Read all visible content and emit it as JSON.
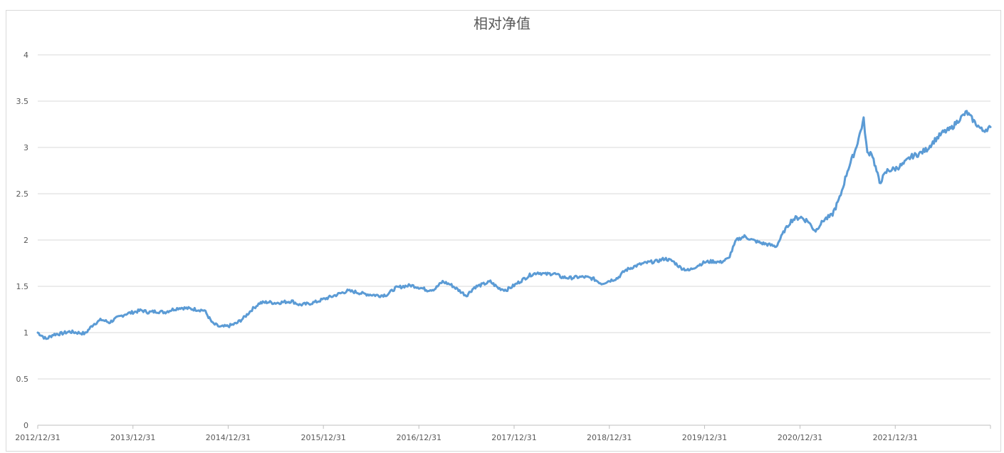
{
  "chart_data": {
    "type": "line",
    "title": "相对净值",
    "xlabel": "",
    "ylabel": "",
    "ylim": [
      0,
      4
    ],
    "yticks": [
      0,
      0.5,
      1,
      1.5,
      2,
      2.5,
      3,
      3.5,
      4
    ],
    "ytick_labels": [
      "0",
      "0.5",
      "1",
      "1.5",
      "2",
      "2.5",
      "3",
      "3.5",
      "4"
    ],
    "xticks": [
      "2012/12/31",
      "2013/12/31",
      "2014/12/31",
      "2015/12/31",
      "2016/12/31",
      "2017/12/31",
      "2018/12/31",
      "2019/12/31",
      "2020/12/31",
      "2021/12/31"
    ],
    "xlim": [
      "2012/12/31",
      "2022/12/31"
    ],
    "grid": true,
    "legend": "none",
    "line_color": "#5b9bd5",
    "series": [
      {
        "x": [
          "2012/12/31",
          "2013/01/15",
          "2013/02/01",
          "2013/03/01",
          "2013/04/01",
          "2013/05/01",
          "2013/06/01",
          "2013/07/01",
          "2013/08/01",
          "2013/09/01",
          "2013/10/01",
          "2013/11/01",
          "2013/12/01",
          "2013/12/31",
          "2014/02/01",
          "2014/03/01",
          "2014/04/01",
          "2014/05/01",
          "2014/06/01",
          "2014/07/01",
          "2014/08/01",
          "2014/09/01",
          "2014/10/01",
          "2014/11/01",
          "2014/12/01",
          "2014/12/31",
          "2015/02/01",
          "2015/03/01",
          "2015/04/01",
          "2015/05/01",
          "2015/06/01",
          "2015/07/01",
          "2015/08/01",
          "2015/09/01",
          "2015/10/01",
          "2015/11/01",
          "2015/12/01",
          "2015/12/31",
          "2016/02/01",
          "2016/03/01",
          "2016/04/01",
          "2016/05/01",
          "2016/06/01",
          "2016/07/01",
          "2016/08/01",
          "2016/09/01",
          "2016/10/01",
          "2016/11/01",
          "2016/12/01",
          "2016/12/31",
          "2017/02/01",
          "2017/03/01",
          "2017/04/01",
          "2017/05/01",
          "2017/06/01",
          "2017/07/01",
          "2017/08/01",
          "2017/09/01",
          "2017/10/01",
          "2017/11/01",
          "2017/12/01",
          "2017/12/31",
          "2018/02/01",
          "2018/03/01",
          "2018/04/01",
          "2018/05/01",
          "2018/06/01",
          "2018/07/01",
          "2018/08/01",
          "2018/09/01",
          "2018/10/01",
          "2018/11/01",
          "2018/12/01",
          "2018/12/31",
          "2019/02/01",
          "2019/03/01",
          "2019/04/01",
          "2019/05/01",
          "2019/06/01",
          "2019/07/01",
          "2019/08/01",
          "2019/09/01",
          "2019/10/01",
          "2019/11/01",
          "2019/12/01",
          "2019/12/31",
          "2020/02/01",
          "2020/03/01",
          "2020/04/01",
          "2020/05/01",
          "2020/06/01",
          "2020/07/01",
          "2020/08/01",
          "2020/09/01",
          "2020/10/01",
          "2020/11/01",
          "2020/12/01",
          "2020/12/31",
          "2021/02/01",
          "2021/02/20",
          "2021/03/01",
          "2021/04/01",
          "2021/05/01",
          "2021/06/01",
          "2021/07/01",
          "2021/08/01",
          "2021/09/01",
          "2021/09/15",
          "2021/10/01",
          "2021/11/01",
          "2021/12/01",
          "2021/12/31",
          "2022/02/01",
          "2022/03/01",
          "2022/04/01",
          "2022/05/01",
          "2022/06/01",
          "2022/07/01",
          "2022/08/01",
          "2022/09/01",
          "2022/10/01",
          "2022/11/01",
          "2022/12/01",
          "2022/12/31"
        ],
        "y": [
          1.0,
          0.97,
          0.93,
          0.98,
          0.99,
          1.01,
          1.0,
          0.99,
          1.09,
          1.14,
          1.11,
          1.16,
          1.2,
          1.22,
          1.24,
          1.22,
          1.23,
          1.22,
          1.25,
          1.27,
          1.26,
          1.25,
          1.24,
          1.1,
          1.06,
          1.07,
          1.1,
          1.16,
          1.25,
          1.32,
          1.33,
          1.32,
          1.33,
          1.34,
          1.3,
          1.31,
          1.33,
          1.36,
          1.39,
          1.42,
          1.45,
          1.44,
          1.42,
          1.41,
          1.4,
          1.41,
          1.48,
          1.5,
          1.51,
          1.49,
          1.46,
          1.47,
          1.55,
          1.52,
          1.46,
          1.4,
          1.49,
          1.52,
          1.55,
          1.48,
          1.46,
          1.51,
          1.57,
          1.62,
          1.65,
          1.63,
          1.64,
          1.6,
          1.59,
          1.6,
          1.6,
          1.58,
          1.53,
          1.56,
          1.59,
          1.67,
          1.71,
          1.74,
          1.76,
          1.77,
          1.8,
          1.77,
          1.7,
          1.67,
          1.72,
          1.76,
          1.77,
          1.76,
          1.8,
          2.0,
          2.04,
          2.0,
          1.97,
          1.95,
          1.93,
          2.1,
          2.22,
          2.25,
          2.2,
          2.12,
          2.1,
          2.22,
          2.26,
          2.45,
          2.75,
          2.98,
          3.3,
          2.93,
          2.95,
          2.62,
          2.75,
          2.77,
          2.82,
          2.9,
          2.93,
          2.98,
          3.08,
          3.16,
          3.2,
          3.3,
          3.38,
          3.27,
          3.18,
          3.22
        ]
      }
    ]
  }
}
